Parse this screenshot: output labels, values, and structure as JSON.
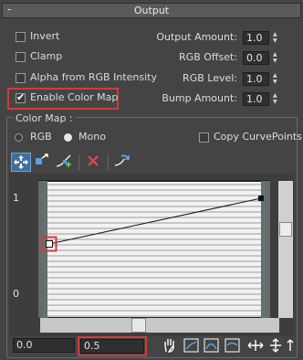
{
  "rollout": {
    "sign": "-",
    "title": "Output"
  },
  "options": {
    "invert": {
      "label": "Invert",
      "checked": false
    },
    "clamp": {
      "label": "Clamp",
      "checked": false
    },
    "alpha_from_rgb": {
      "label": "Alpha from RGB Intensity",
      "checked": false
    },
    "enable_color_map": {
      "label": "Enable Color Map",
      "checked": true
    }
  },
  "spinners": {
    "output_amount": {
      "label": "Output Amount:",
      "value": "1.0"
    },
    "rgb_offset": {
      "label": "RGB Offset:",
      "value": "0.0"
    },
    "rgb_level": {
      "label": "RGB Level:",
      "value": "1.0"
    },
    "bump_amount": {
      "label": "Bump Amount:",
      "value": "1.0"
    }
  },
  "color_map": {
    "group_label": "Color Map :",
    "rgb_label": "RGB",
    "mono_label": "Mono",
    "mode_selected": "Mono",
    "copy_curve_points": {
      "label": "Copy CurvePoints",
      "checked": false
    },
    "y_axis_top": "1",
    "y_axis_bottom": "0",
    "curve_points": [
      {
        "x": 0.0,
        "y": 0.5
      },
      {
        "x": 1.0,
        "y": 1.0
      }
    ],
    "selected_point": 0,
    "coord_x": "0.0",
    "coord_y": "0.5"
  },
  "icons": {
    "toolbar": [
      "move-icon",
      "scale-point-icon",
      "add-point-icon",
      "delete-point-icon",
      "reset-curve-icon"
    ],
    "bottom": [
      "pan-icon",
      "zoom-extents-icon",
      "zoom-horizontal-extents-icon",
      "zoom-vertical-extents-icon",
      "zoom-horizontal-icon",
      "zoom-vertical-icon"
    ]
  },
  "colors": {
    "panel_bg": "#444444",
    "highlight_red": "#d43a3a",
    "active_tool": "#3f6f9c",
    "graph_bg": "#f2f2f2"
  }
}
